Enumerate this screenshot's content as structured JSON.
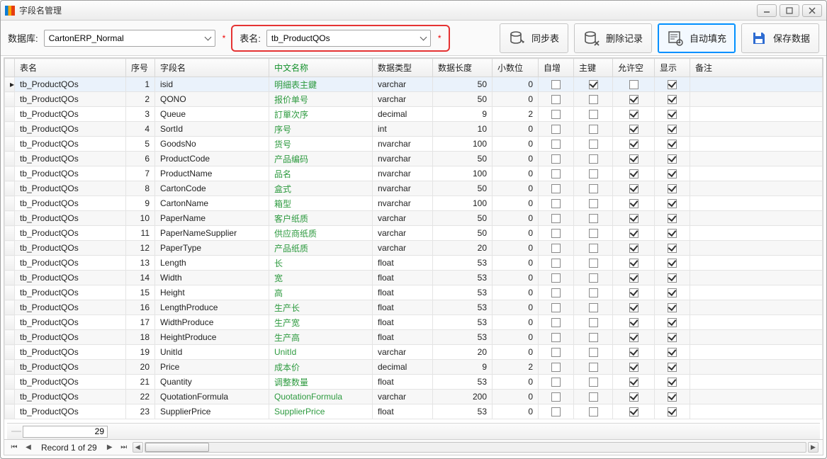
{
  "window": {
    "title": "字段名管理"
  },
  "toolbar": {
    "db_label": "数据库:",
    "db_value": "CartonERP_Normal",
    "table_label": "表名:",
    "table_value": "tb_ProductQOs",
    "sync_btn": "同步表",
    "delete_btn": "删除记录",
    "autofill_btn": "自动填充",
    "save_btn": "保存数据"
  },
  "grid": {
    "headers": {
      "tableName": "表名",
      "seq": "序号",
      "fieldName": "字段名",
      "cnName": "中文名称",
      "dataType": "数据类型",
      "dataLen": "数据长度",
      "decimals": "小数位",
      "autoInc": "自增",
      "pk": "主键",
      "nullable": "允许空",
      "display": "显示",
      "remark": "备注"
    },
    "rows": [
      {
        "t": "tb_ProductQOs",
        "seq": 1,
        "f": "isid",
        "cn": "明細表主鍵",
        "dt": "varchar",
        "len": 50,
        "dec": 0,
        "ai": false,
        "pk": true,
        "nl": false,
        "dp": true
      },
      {
        "t": "tb_ProductQOs",
        "seq": 2,
        "f": "QONO",
        "cn": "报价单号",
        "dt": "varchar",
        "len": 50,
        "dec": 0,
        "ai": false,
        "pk": false,
        "nl": true,
        "dp": true
      },
      {
        "t": "tb_ProductQOs",
        "seq": 3,
        "f": "Queue",
        "cn": "訂單次序",
        "dt": "decimal",
        "len": 9,
        "dec": 2,
        "ai": false,
        "pk": false,
        "nl": true,
        "dp": true
      },
      {
        "t": "tb_ProductQOs",
        "seq": 4,
        "f": "SortId",
        "cn": "序号",
        "dt": "int",
        "len": 10,
        "dec": 0,
        "ai": false,
        "pk": false,
        "nl": true,
        "dp": true
      },
      {
        "t": "tb_ProductQOs",
        "seq": 5,
        "f": "GoodsNo",
        "cn": "货号",
        "dt": "nvarchar",
        "len": 100,
        "dec": 0,
        "ai": false,
        "pk": false,
        "nl": true,
        "dp": true
      },
      {
        "t": "tb_ProductQOs",
        "seq": 6,
        "f": "ProductCode",
        "cn": "产品编码",
        "dt": "nvarchar",
        "len": 50,
        "dec": 0,
        "ai": false,
        "pk": false,
        "nl": true,
        "dp": true
      },
      {
        "t": "tb_ProductQOs",
        "seq": 7,
        "f": "ProductName",
        "cn": "品名",
        "dt": "nvarchar",
        "len": 100,
        "dec": 0,
        "ai": false,
        "pk": false,
        "nl": true,
        "dp": true
      },
      {
        "t": "tb_ProductQOs",
        "seq": 8,
        "f": "CartonCode",
        "cn": "盒式",
        "dt": "nvarchar",
        "len": 50,
        "dec": 0,
        "ai": false,
        "pk": false,
        "nl": true,
        "dp": true
      },
      {
        "t": "tb_ProductQOs",
        "seq": 9,
        "f": "CartonName",
        "cn": "箱型",
        "dt": "nvarchar",
        "len": 100,
        "dec": 0,
        "ai": false,
        "pk": false,
        "nl": true,
        "dp": true
      },
      {
        "t": "tb_ProductQOs",
        "seq": 10,
        "f": "PaperName",
        "cn": "客户纸质",
        "dt": "varchar",
        "len": 50,
        "dec": 0,
        "ai": false,
        "pk": false,
        "nl": true,
        "dp": true
      },
      {
        "t": "tb_ProductQOs",
        "seq": 11,
        "f": "PaperNameSupplier",
        "cn": "供应商纸质",
        "dt": "varchar",
        "len": 50,
        "dec": 0,
        "ai": false,
        "pk": false,
        "nl": true,
        "dp": true
      },
      {
        "t": "tb_ProductQOs",
        "seq": 12,
        "f": "PaperType",
        "cn": "产品纸质",
        "dt": "varchar",
        "len": 20,
        "dec": 0,
        "ai": false,
        "pk": false,
        "nl": true,
        "dp": true
      },
      {
        "t": "tb_ProductQOs",
        "seq": 13,
        "f": "Length",
        "cn": "长",
        "dt": "float",
        "len": 53,
        "dec": 0,
        "ai": false,
        "pk": false,
        "nl": true,
        "dp": true
      },
      {
        "t": "tb_ProductQOs",
        "seq": 14,
        "f": "Width",
        "cn": "宽",
        "dt": "float",
        "len": 53,
        "dec": 0,
        "ai": false,
        "pk": false,
        "nl": true,
        "dp": true
      },
      {
        "t": "tb_ProductQOs",
        "seq": 15,
        "f": "Height",
        "cn": "高",
        "dt": "float",
        "len": 53,
        "dec": 0,
        "ai": false,
        "pk": false,
        "nl": true,
        "dp": true
      },
      {
        "t": "tb_ProductQOs",
        "seq": 16,
        "f": "LengthProduce",
        "cn": "生产长",
        "dt": "float",
        "len": 53,
        "dec": 0,
        "ai": false,
        "pk": false,
        "nl": true,
        "dp": true
      },
      {
        "t": "tb_ProductQOs",
        "seq": 17,
        "f": "WidthProduce",
        "cn": "生产宽",
        "dt": "float",
        "len": 53,
        "dec": 0,
        "ai": false,
        "pk": false,
        "nl": true,
        "dp": true
      },
      {
        "t": "tb_ProductQOs",
        "seq": 18,
        "f": "HeightProduce",
        "cn": "生产高",
        "dt": "float",
        "len": 53,
        "dec": 0,
        "ai": false,
        "pk": false,
        "nl": true,
        "dp": true
      },
      {
        "t": "tb_ProductQOs",
        "seq": 19,
        "f": "UnitId",
        "cn": "UnitId",
        "dt": "varchar",
        "len": 20,
        "dec": 0,
        "ai": false,
        "pk": false,
        "nl": true,
        "dp": true
      },
      {
        "t": "tb_ProductQOs",
        "seq": 20,
        "f": "Price",
        "cn": "成本价",
        "dt": "decimal",
        "len": 9,
        "dec": 2,
        "ai": false,
        "pk": false,
        "nl": true,
        "dp": true
      },
      {
        "t": "tb_ProductQOs",
        "seq": 21,
        "f": "Quantity",
        "cn": "调整数量",
        "dt": "float",
        "len": 53,
        "dec": 0,
        "ai": false,
        "pk": false,
        "nl": true,
        "dp": true
      },
      {
        "t": "tb_ProductQOs",
        "seq": 22,
        "f": "QuotationFormula",
        "cn": "QuotationFormula",
        "dt": "varchar",
        "len": 200,
        "dec": 0,
        "ai": false,
        "pk": false,
        "nl": true,
        "dp": true
      },
      {
        "t": "tb_ProductQOs",
        "seq": 23,
        "f": "SupplierPrice",
        "cn": "SupplierPrice",
        "dt": "float",
        "len": 53,
        "dec": 0,
        "ai": false,
        "pk": false,
        "nl": true,
        "dp": true
      }
    ]
  },
  "footer": {
    "sumValue": "29"
  },
  "nav": {
    "record": "Record 1 of 29"
  }
}
